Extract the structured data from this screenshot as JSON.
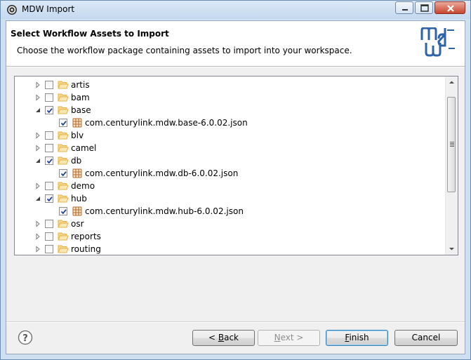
{
  "window": {
    "title": "MDW Import"
  },
  "header": {
    "title": "Select Workflow Assets to Import",
    "description": "Choose the workflow package containing assets to import into your workspace."
  },
  "tree": {
    "items": [
      {
        "label": "artis",
        "type": "folder",
        "expanded": false,
        "checked": false
      },
      {
        "label": "bam",
        "type": "folder",
        "expanded": false,
        "checked": false
      },
      {
        "label": "base",
        "type": "folder",
        "expanded": true,
        "checked": true
      },
      {
        "label": "com.centurylink.mdw.base-6.0.02.json",
        "type": "package",
        "checked": true
      },
      {
        "label": "blv",
        "type": "folder",
        "expanded": false,
        "checked": false
      },
      {
        "label": "camel",
        "type": "folder",
        "expanded": false,
        "checked": false
      },
      {
        "label": "db",
        "type": "folder",
        "expanded": true,
        "checked": true
      },
      {
        "label": "com.centurylink.mdw.db-6.0.02.json",
        "type": "package",
        "checked": true
      },
      {
        "label": "demo",
        "type": "folder",
        "expanded": false,
        "checked": false
      },
      {
        "label": "hub",
        "type": "folder",
        "expanded": true,
        "checked": true
      },
      {
        "label": "com.centurylink.mdw.hub-6.0.02.json",
        "type": "package",
        "checked": true
      },
      {
        "label": "osr",
        "type": "folder",
        "expanded": false,
        "checked": false
      },
      {
        "label": "reports",
        "type": "folder",
        "expanded": false,
        "checked": false
      },
      {
        "label": "routing",
        "type": "folder",
        "expanded": false,
        "checked": false
      }
    ]
  },
  "buttons": {
    "back_prefix": "< ",
    "back_mnemonic": "B",
    "back_rest": "ack",
    "next_mnemonic": "N",
    "next_rest": "ext >",
    "finish_mnemonic": "F",
    "finish_rest": "inish",
    "cancel": "Cancel"
  },
  "colors": {
    "folder": "#e8b24a",
    "package": "#b46a2a",
    "check": "#1a3c8f",
    "accent": "#3c7fb1"
  }
}
